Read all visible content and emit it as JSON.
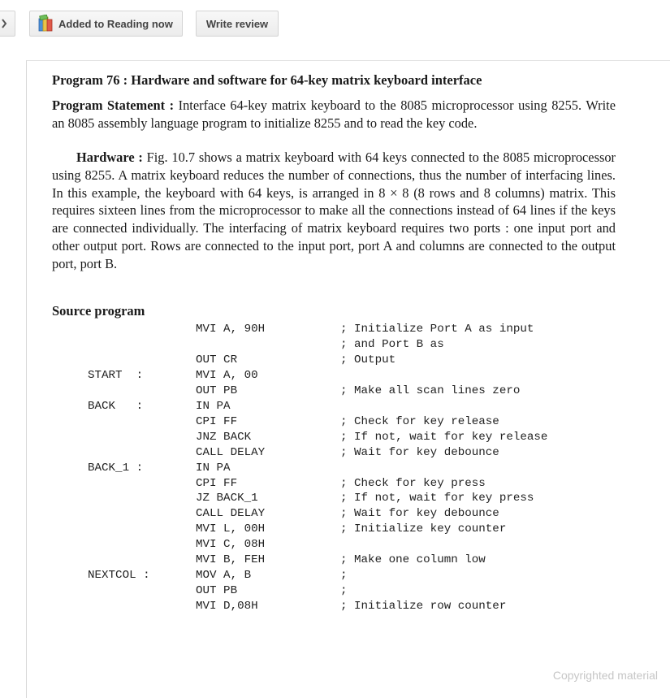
{
  "toolbar": {
    "reading_label": "Added to Reading now",
    "review_label": "Write review"
  },
  "page": {
    "program_title": "Program 76 : Hardware and software for 64-key matrix keyboard interface",
    "statement_label": "Program Statement :",
    "statement_text": " Interface 64-key matrix keyboard to the 8085 microprocessor using 8255. Write an 8085 assembly language program to initialize 8255 and to read the key code.",
    "hardware_label": "Hardware :",
    "hardware_text": " Fig. 10.7 shows a matrix keyboard with 64 keys connected to the 8085 microprocessor using 8255. A matrix keyboard reduces the number of connections, thus the number of interfacing lines. In this example, the keyboard with 64 keys, is arranged in 8 × 8 (8 rows and 8 columns) matrix. This requires sixteen lines from the microprocessor to make all the connections instead of 64 lines if the keys are connected individually. The interfacing of matrix keyboard requires two ports : one input port and other output port. Rows are connected to the input port, port A and columns are connected to the output port, port B.",
    "source_heading": "Source program",
    "code_lines": [
      {
        "label": "",
        "instr": "MVI A, 90H",
        "comment": "; Initialize Port A as input"
      },
      {
        "label": "",
        "instr": "",
        "comment": "; and Port B as"
      },
      {
        "label": "",
        "instr": "OUT CR",
        "comment": "; Output"
      },
      {
        "label": "START  :",
        "instr": "MVI A, 00",
        "comment": ""
      },
      {
        "label": "",
        "instr": "OUT PB",
        "comment": "; Make all scan lines zero"
      },
      {
        "label": "BACK   :",
        "instr": "IN PA",
        "comment": ""
      },
      {
        "label": "",
        "instr": "CPI FF",
        "comment": "; Check for key release"
      },
      {
        "label": "",
        "instr": "JNZ BACK",
        "comment": "; If not, wait for key release"
      },
      {
        "label": "",
        "instr": "CALL DELAY",
        "comment": "; Wait for key debounce"
      },
      {
        "label": "BACK_1 :",
        "instr": "IN PA",
        "comment": ""
      },
      {
        "label": "",
        "instr": "CPI FF",
        "comment": "; Check for key press"
      },
      {
        "label": "",
        "instr": "JZ BACK_1",
        "comment": "; If not, wait for key press"
      },
      {
        "label": "",
        "instr": "CALL DELAY",
        "comment": "; Wait for key debounce"
      },
      {
        "label": "",
        "instr": "MVI L, 00H",
        "comment": "; Initialize key counter"
      },
      {
        "label": "",
        "instr": "MVI C, 08H",
        "comment": ""
      },
      {
        "label": "",
        "instr": "MVI B, FEH",
        "comment": "; Make one column low"
      },
      {
        "label": "NEXTCOL :",
        "instr": "MOV A, B",
        "comment": ";"
      },
      {
        "label": "",
        "instr": "OUT PB",
        "comment": ";"
      },
      {
        "label": "",
        "instr": "MVI D,08H",
        "comment": "; Initialize row counter"
      }
    ],
    "watermark": "Copyrighted material"
  }
}
